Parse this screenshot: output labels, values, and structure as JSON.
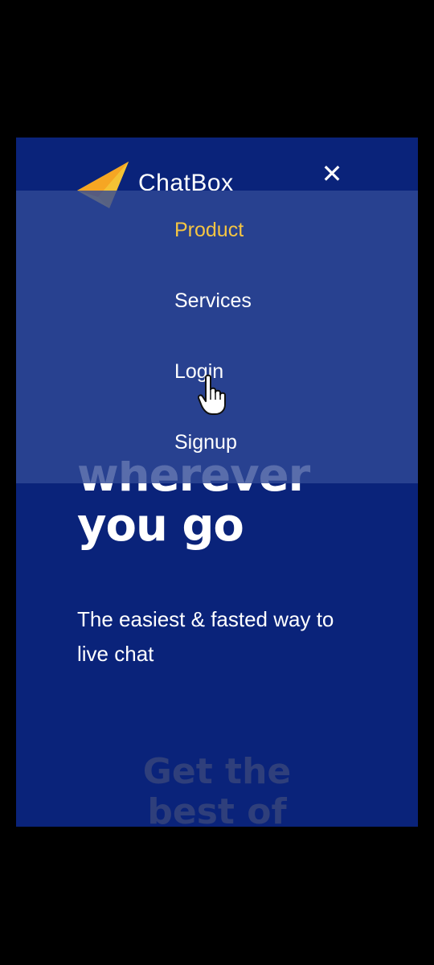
{
  "header": {
    "brand": "ChatBox",
    "close_symbol": "✕",
    "logo_icon": "paper-plane-icon"
  },
  "menu": {
    "items": [
      {
        "label": "Product",
        "active": true
      },
      {
        "label": "Services",
        "active": false
      },
      {
        "label": "Login",
        "active": false
      },
      {
        "label": "Signup",
        "active": false
      }
    ]
  },
  "hero": {
    "title_partial": "wherever",
    "title_line2": "you go",
    "subtitle": "The easiest & fasted way to live chat"
  },
  "promo": {
    "text_line1": "Get the",
    "text_line2": "best of"
  },
  "colors": {
    "background": "#0a237a",
    "menu_active": "#f5c542",
    "text": "#ffffff"
  }
}
